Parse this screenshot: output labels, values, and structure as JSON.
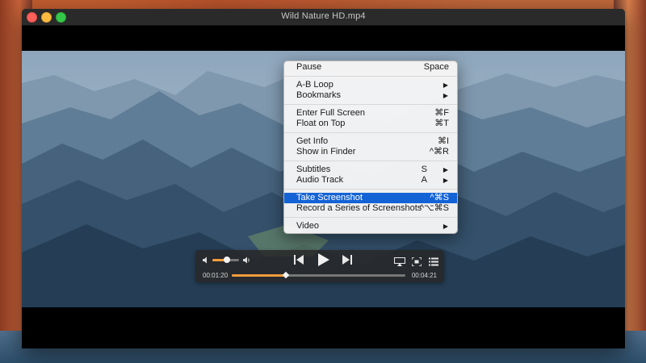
{
  "window": {
    "title": "Wild Nature HD.mp4"
  },
  "menu": {
    "items": [
      {
        "label": "Pause",
        "shortcut": "Space"
      },
      {
        "label": "A-B Loop",
        "submenu": true
      },
      {
        "label": "Bookmarks",
        "submenu": true
      },
      {
        "label": "Enter Full Screen",
        "shortcut": "⌘F"
      },
      {
        "label": "Float on Top",
        "shortcut": "⌘T"
      },
      {
        "label": "Get Info",
        "shortcut": "⌘I"
      },
      {
        "label": "Show in Finder",
        "shortcut": "^⌘R"
      },
      {
        "label": "Subtitles",
        "shortcut": "S",
        "submenu": true
      },
      {
        "label": "Audio Track",
        "shortcut": "A",
        "submenu": true
      },
      {
        "label": "Take Screenshot",
        "shortcut": "^⌘S",
        "highlighted": true
      },
      {
        "label": "Record a Series of Screenshots",
        "shortcut": "^⌥⌘S"
      },
      {
        "label": "Video",
        "submenu": true
      }
    ],
    "submenu_arrow": "▶"
  },
  "controls": {
    "current_time": "00:01:20",
    "total_time": "00:04:21",
    "progress_fraction": 0.31,
    "volume_fraction": 0.55,
    "accent_color": "#f39c3c",
    "icons": [
      "volume-low-icon",
      "volume-high-icon",
      "previous-icon",
      "play-icon",
      "next-icon",
      "airplay-icon",
      "fit-screen-icon",
      "playlist-icon"
    ]
  },
  "colors": {
    "menu_highlight": "#1463d6",
    "close": "#fc605b",
    "minimize": "#fdbc40",
    "maximize": "#34c84a"
  }
}
